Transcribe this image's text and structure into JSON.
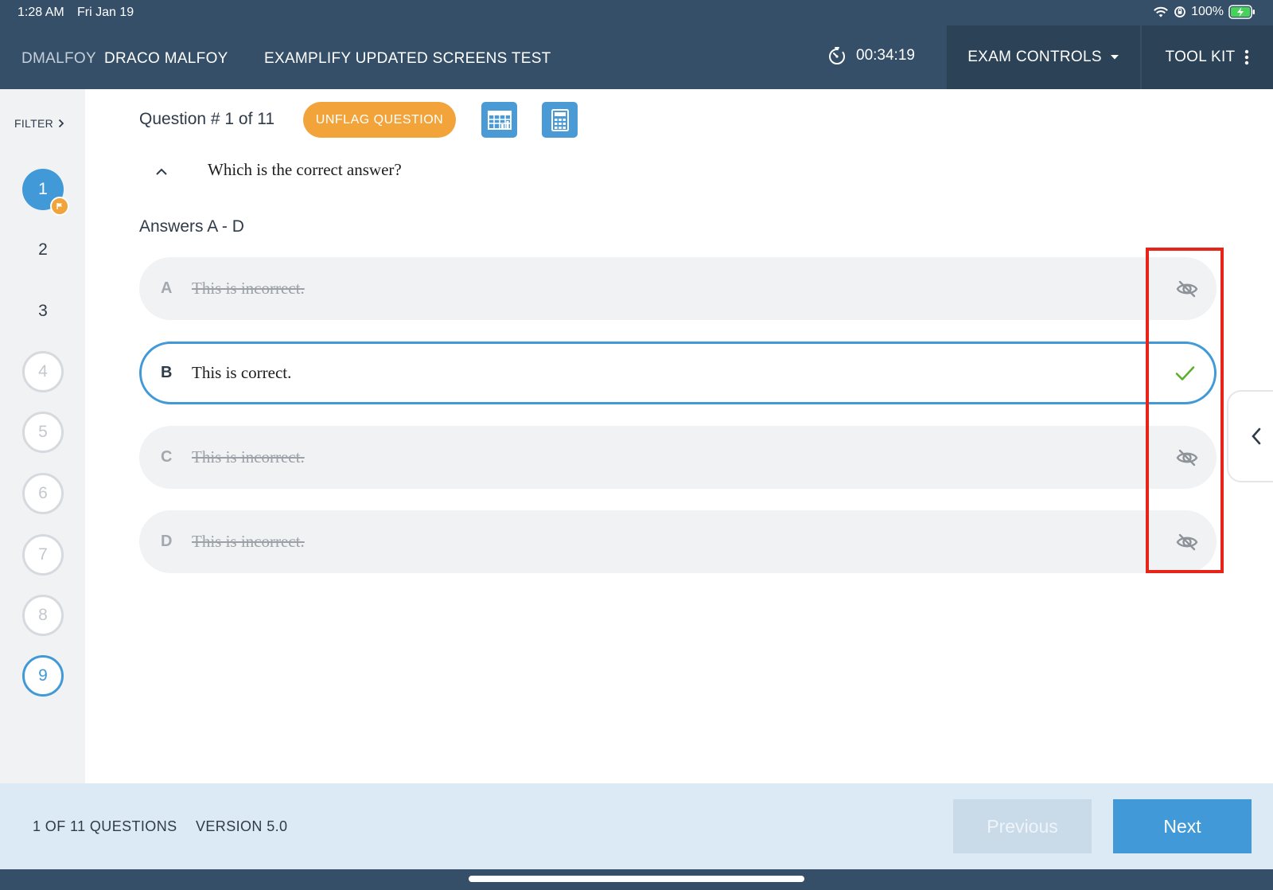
{
  "status_bar": {
    "time": "1:28 AM",
    "date": "Fri Jan 19",
    "battery": "100%"
  },
  "header": {
    "user_id": "DMALFOY",
    "user_name": "DRACO MALFOY",
    "exam_title": "EXAMPLIFY UPDATED SCREENS TEST",
    "timer": "00:34:19",
    "exam_controls_label": "EXAM CONTROLS",
    "toolkit_label": "TOOL KIT"
  },
  "sidebar": {
    "filter_label": "FILTER",
    "questions": [
      {
        "label": "1",
        "state": "active",
        "flagged": true
      },
      {
        "label": "2",
        "state": "plain"
      },
      {
        "label": "3",
        "state": "plain"
      },
      {
        "label": "4",
        "state": "unanswered"
      },
      {
        "label": "5",
        "state": "unanswered"
      },
      {
        "label": "6",
        "state": "unanswered"
      },
      {
        "label": "7",
        "state": "unanswered"
      },
      {
        "label": "8",
        "state": "unanswered"
      },
      {
        "label": "9",
        "state": "answered"
      }
    ]
  },
  "question": {
    "number_label": "Question # 1 of 11",
    "unflag_label": "UNFLAG QUESTION",
    "text": "Which is the correct answer?",
    "answers_label": "Answers A - D",
    "answers": [
      {
        "letter": "A",
        "text": "This is incorrect.",
        "state": "eliminated",
        "icon": "eye-slash-icon"
      },
      {
        "letter": "B",
        "text": "This is correct.",
        "state": "selected",
        "icon": "check-icon"
      },
      {
        "letter": "C",
        "text": "This is incorrect.",
        "state": "eliminated",
        "icon": "eye-slash-icon"
      },
      {
        "letter": "D",
        "text": "This is incorrect.",
        "state": "eliminated",
        "icon": "eye-slash-icon"
      }
    ]
  },
  "footer": {
    "count_label": "1 OF 11 QUESTIONS",
    "version_label": "VERSION 5.0",
    "previous_label": "Previous",
    "next_label": "Next"
  },
  "colors": {
    "header_bg": "#354f68",
    "accent_blue": "#4199d8",
    "flag_orange": "#f2a43a",
    "highlight_red": "#e8231a",
    "check_green": "#5cb02d"
  }
}
